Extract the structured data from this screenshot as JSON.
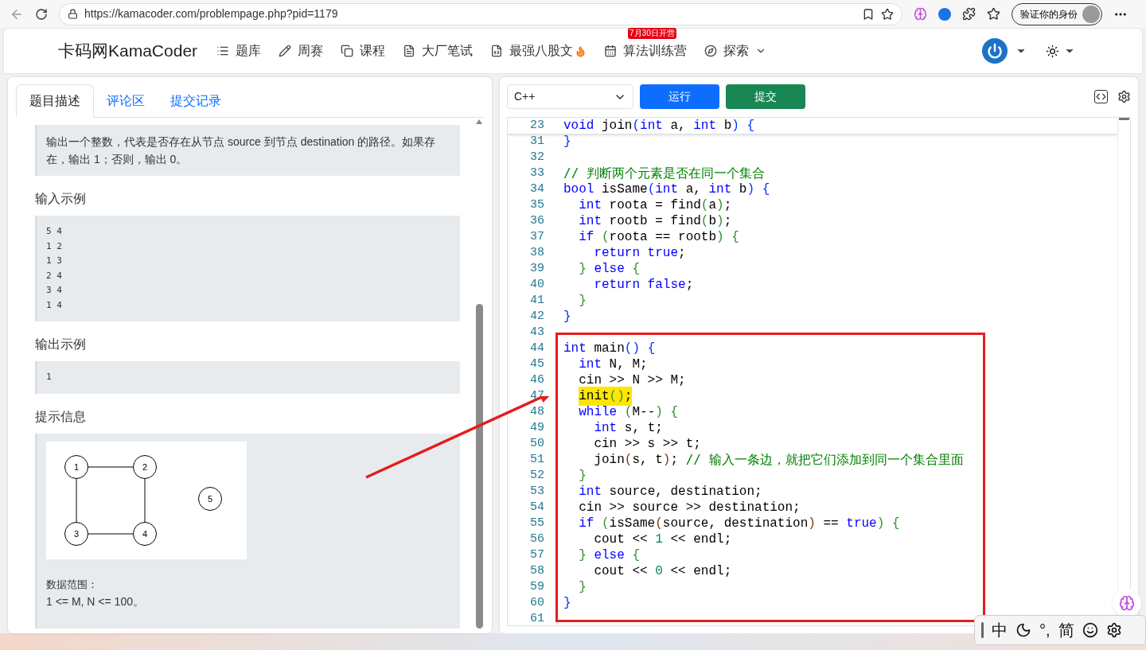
{
  "browser": {
    "url": "https://kamacoder.com/problempage.php?pid=1179",
    "profile_button": "验证你的身份"
  },
  "navbar": {
    "logo": "卡码网KamaCoder",
    "items": [
      {
        "label": "题库",
        "fire": false,
        "dropdown": false
      },
      {
        "label": "周赛",
        "fire": false,
        "dropdown": false
      },
      {
        "label": "课程",
        "fire": false,
        "dropdown": false
      },
      {
        "label": "大厂笔试",
        "fire": false,
        "dropdown": false
      },
      {
        "label": "最强八股文",
        "fire": true,
        "dropdown": false
      },
      {
        "label": "算法训练营",
        "badge": "7月30日开营",
        "fire": false,
        "dropdown": false
      },
      {
        "label": "探索",
        "fire": false,
        "dropdown": true
      }
    ]
  },
  "problem_tabs": [
    {
      "label": "题目描述",
      "selected": true
    },
    {
      "label": "评论区",
      "selected": false
    },
    {
      "label": "提交记录",
      "selected": false
    }
  ],
  "problem": {
    "output_desc": "输出一个整数，代表是否存在从节点 source 到节点 destination 的路径。如果存在，输出 1；否则，输出 0。",
    "sections": [
      {
        "heading": "输入示例",
        "sample": [
          "5 4",
          "1 2",
          "1 3",
          "2 4",
          "3 4",
          "1 4"
        ]
      },
      {
        "heading": "输出示例",
        "sample": [
          "1"
        ]
      }
    ],
    "hint": {
      "heading": "提示信息",
      "graph_nodes": [
        "1",
        "2",
        "3",
        "4",
        "5"
      ],
      "range_label": "数据范围：",
      "range": "1 <= M, N <= 100。"
    }
  },
  "editor": {
    "language": "C++",
    "run": "运行",
    "submit": "提交",
    "lines": [
      {
        "n": "23",
        "highlighted": false,
        "code": [
          {
            "kind": "kw",
            "text": "void"
          },
          {
            "kind": "pl",
            "text": " join"
          },
          {
            "kind": "p1",
            "text": "("
          },
          {
            "kind": "kw",
            "text": "int"
          },
          {
            "kind": "pl",
            "text": " a, "
          },
          {
            "kind": "kw",
            "text": "int"
          },
          {
            "kind": "pl",
            "text": " b"
          },
          {
            "kind": "p1",
            "text": ")"
          },
          {
            "kind": "p1",
            "text": " {"
          }
        ]
      },
      {
        "n": "31",
        "highlighted": false,
        "code": [
          {
            "kind": "p1",
            "text": "}"
          }
        ]
      },
      {
        "n": "32"
      },
      {
        "n": "33",
        "highlighted": false,
        "code": [
          {
            "kind": "cm",
            "text": "// 判断两个元素是否在同一个集合"
          }
        ]
      },
      {
        "n": "34",
        "highlighted": false,
        "code": [
          {
            "kind": "kw",
            "text": "bool"
          },
          {
            "kind": "pl",
            "text": " isSame"
          },
          {
            "kind": "p1",
            "text": "("
          },
          {
            "kind": "kw",
            "text": "int"
          },
          {
            "kind": "pl",
            "text": " a, "
          },
          {
            "kind": "kw",
            "text": "int"
          },
          {
            "kind": "pl",
            "text": " b"
          },
          {
            "kind": "p1",
            "text": ")"
          },
          {
            "kind": "p1",
            "text": " {"
          }
        ]
      },
      {
        "n": "35",
        "highlighted": false,
        "code": [
          {
            "kind": "kw",
            "text": "  int"
          },
          {
            "kind": "pl",
            "text": " roota = find"
          },
          {
            "kind": "p2",
            "text": "("
          },
          {
            "kind": "pl",
            "text": "a"
          },
          {
            "kind": "p2",
            "text": ")"
          },
          {
            "kind": "pl",
            "text": ";"
          }
        ]
      },
      {
        "n": "36",
        "highlighted": false,
        "code": [
          {
            "kind": "kw",
            "text": "  int"
          },
          {
            "kind": "pl",
            "text": " rootb = find"
          },
          {
            "kind": "p2",
            "text": "("
          },
          {
            "kind": "pl",
            "text": "b"
          },
          {
            "kind": "p2",
            "text": ")"
          },
          {
            "kind": "pl",
            "text": ";"
          }
        ]
      },
      {
        "n": "37",
        "highlighted": false,
        "code": [
          {
            "kind": "kw",
            "text": "  if"
          },
          {
            "kind": "p2",
            "text": " ("
          },
          {
            "kind": "pl",
            "text": "roota == rootb"
          },
          {
            "kind": "p2",
            "text": ")"
          },
          {
            "kind": "p2",
            "text": " {"
          }
        ]
      },
      {
        "n": "38",
        "highlighted": false,
        "code": [
          {
            "kind": "kw",
            "text": "    return"
          },
          {
            "kind": "kw",
            "text": " true"
          },
          {
            "kind": "pl",
            "text": ";"
          }
        ]
      },
      {
        "n": "39",
        "highlighted": false,
        "code": [
          {
            "kind": "p2",
            "text": "  }"
          },
          {
            "kind": "kw",
            "text": " else"
          },
          {
            "kind": "p2",
            "text": " {"
          }
        ]
      },
      {
        "n": "40",
        "highlighted": false,
        "code": [
          {
            "kind": "kw",
            "text": "    return"
          },
          {
            "kind": "kw",
            "text": " false"
          },
          {
            "kind": "pl",
            "text": ";"
          }
        ]
      },
      {
        "n": "41",
        "highlighted": false,
        "code": [
          {
            "kind": "p2",
            "text": "  }"
          }
        ]
      },
      {
        "n": "42",
        "highlighted": false,
        "code": [
          {
            "kind": "p1",
            "text": "}"
          }
        ]
      },
      {
        "n": "43"
      },
      {
        "n": "44",
        "highlighted": false,
        "code": [
          {
            "kind": "kw",
            "text": "int"
          },
          {
            "kind": "pl",
            "text": " main"
          },
          {
            "kind": "p1",
            "text": "()"
          },
          {
            "kind": "p1",
            "text": " {"
          }
        ]
      },
      {
        "n": "45",
        "highlighted": false,
        "code": [
          {
            "kind": "kw",
            "text": "  int"
          },
          {
            "kind": "pl",
            "text": " N, M;"
          }
        ]
      },
      {
        "n": "46",
        "highlighted": false,
        "code": [
          {
            "kind": "pl",
            "text": "  cin >> N >> M;"
          }
        ]
      },
      {
        "n": "47",
        "highlighted": true,
        "code": [
          {
            "kind": "pl",
            "text": "  init"
          },
          {
            "kind": "p2",
            "text": "()"
          },
          {
            "kind": "pl",
            "text": ";"
          }
        ]
      },
      {
        "n": "48",
        "highlighted": false,
        "code": [
          {
            "kind": "kw",
            "text": "  while"
          },
          {
            "kind": "p2",
            "text": " ("
          },
          {
            "kind": "pl",
            "text": "M--"
          },
          {
            "kind": "p2",
            "text": ")"
          },
          {
            "kind": "p2",
            "text": " {"
          }
        ]
      },
      {
        "n": "49",
        "highlighted": false,
        "code": [
          {
            "kind": "kw",
            "text": "    int"
          },
          {
            "kind": "pl",
            "text": " s, t;"
          }
        ]
      },
      {
        "n": "50",
        "highlighted": false,
        "code": [
          {
            "kind": "pl",
            "text": "    cin >> s >> t;"
          }
        ]
      },
      {
        "n": "51",
        "highlighted": false,
        "code": [
          {
            "kind": "pl",
            "text": "    join"
          },
          {
            "kind": "p3",
            "text": "("
          },
          {
            "kind": "pl",
            "text": "s, t"
          },
          {
            "kind": "p3",
            "text": ")"
          },
          {
            "kind": "pl",
            "text": ";"
          },
          {
            "kind": "cm",
            "text": " // 输入一条边，就把它们添加到同一个集合里面"
          }
        ]
      },
      {
        "n": "52",
        "highlighted": false,
        "code": [
          {
            "kind": "p2",
            "text": "  }"
          }
        ]
      },
      {
        "n": "53",
        "highlighted": false,
        "code": [
          {
            "kind": "kw",
            "text": "  int"
          },
          {
            "kind": "pl",
            "text": " source, destination;"
          }
        ]
      },
      {
        "n": "54",
        "highlighted": false,
        "code": [
          {
            "kind": "pl",
            "text": "  cin >> source >> destination;"
          }
        ]
      },
      {
        "n": "55",
        "highlighted": false,
        "code": [
          {
            "kind": "kw",
            "text": "  if"
          },
          {
            "kind": "p2",
            "text": " ("
          },
          {
            "kind": "pl",
            "text": "isSame"
          },
          {
            "kind": "p3",
            "text": "("
          },
          {
            "kind": "pl",
            "text": "source, destination"
          },
          {
            "kind": "p3",
            "text": ")"
          },
          {
            "kind": "pl",
            "text": " =="
          },
          {
            "kind": "kw",
            "text": " true"
          },
          {
            "kind": "p2",
            "text": ")"
          },
          {
            "kind": "p2",
            "text": " {"
          }
        ]
      },
      {
        "n": "56",
        "highlighted": false,
        "code": [
          {
            "kind": "pl",
            "text": "    cout << "
          },
          {
            "kind": "nm",
            "text": "1"
          },
          {
            "kind": "pl",
            "text": " << endl;"
          }
        ]
      },
      {
        "n": "57",
        "highlighted": false,
        "code": [
          {
            "kind": "p2",
            "text": "  }"
          },
          {
            "kind": "kw",
            "text": " else"
          },
          {
            "kind": "p2",
            "text": " {"
          }
        ]
      },
      {
        "n": "58",
        "highlighted": false,
        "code": [
          {
            "kind": "pl",
            "text": "    cout << "
          },
          {
            "kind": "nm",
            "text": "0"
          },
          {
            "kind": "pl",
            "text": " << endl;"
          }
        ]
      },
      {
        "n": "59",
        "highlighted": false,
        "code": [
          {
            "kind": "p2",
            "text": "  }"
          }
        ]
      },
      {
        "n": "60",
        "highlighted": false,
        "code": [
          {
            "kind": "p1",
            "text": "}"
          }
        ]
      },
      {
        "n": "61"
      }
    ]
  },
  "ime_toolbar": {
    "mode": "中",
    "punct": "°,",
    "script": "简"
  }
}
